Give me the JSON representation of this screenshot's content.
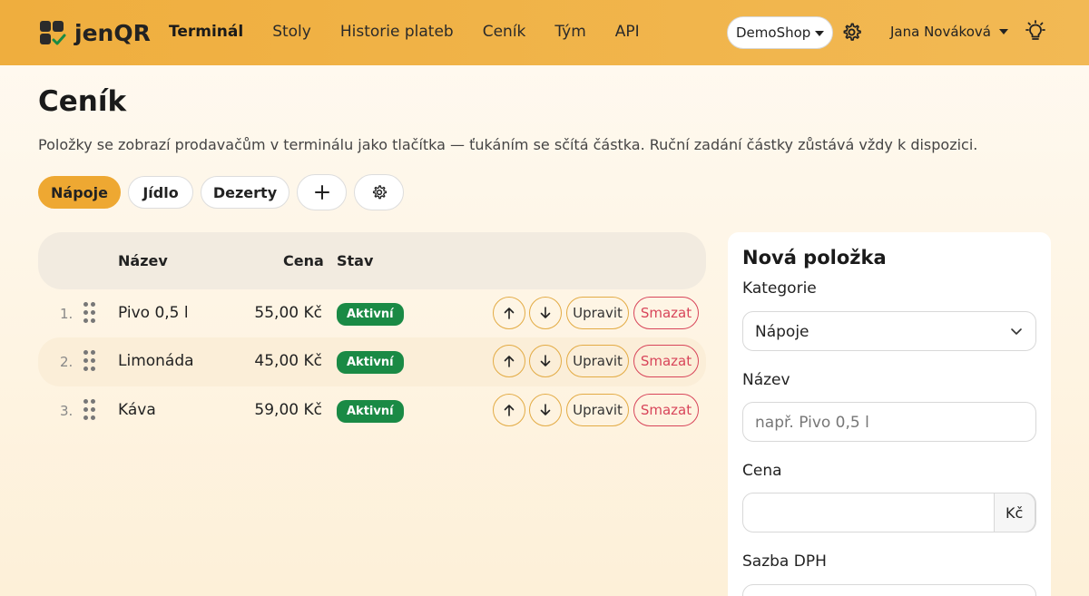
{
  "app": {
    "brand": "jenQR"
  },
  "nav": {
    "links": [
      "Terminál",
      "Stoly",
      "Historie plateb",
      "Ceník",
      "Tým",
      "API"
    ],
    "active_index": 0
  },
  "header": {
    "shop": "DemoShop",
    "user": "Jana Nováková"
  },
  "page": {
    "title": "Ceník",
    "description": "Položky se zobrazí prodavačům v terminálu jako tlačítka — ťukáním se sčítá částka. Ruční zadání částky zůstává vždy k dispozici."
  },
  "categories": {
    "items": [
      "Nápoje",
      "Jídlo",
      "Dezerty"
    ],
    "active_index": 0,
    "add_label": "+"
  },
  "table": {
    "headers": {
      "name": "Název",
      "price": "Cena",
      "status": "Stav"
    },
    "rows": [
      {
        "index": "1.",
        "name": "Pivo 0,5 l",
        "price": "55,00 Kč",
        "status": "Aktivní"
      },
      {
        "index": "2.",
        "name": "Limonáda",
        "price": "45,00 Kč",
        "status": "Aktivní"
      },
      {
        "index": "3.",
        "name": "Káva",
        "price": "59,00 Kč",
        "status": "Aktivní"
      }
    ],
    "edit_label": "Upravit",
    "delete_label": "Smazat"
  },
  "form": {
    "title": "Nová položka",
    "category_label": "Kategorie",
    "category_value": "Nápoje",
    "name_label": "Název",
    "name_placeholder": "např. Pivo 0,5 l",
    "price_label": "Cena",
    "price_value": "",
    "currency": "Kč",
    "vat_label": "Sazba DPH"
  },
  "colors": {
    "accent": "#eea832",
    "status_active": "#1a8a45",
    "danger": "#d8455a"
  },
  "icons": [
    "grid-check-logo-icon",
    "gear-icon",
    "caret-down-icon",
    "lightbulb-icon",
    "plus-icon",
    "arrow-up-icon",
    "arrow-down-icon",
    "drag-handle-icon",
    "chevron-down-icon"
  ]
}
